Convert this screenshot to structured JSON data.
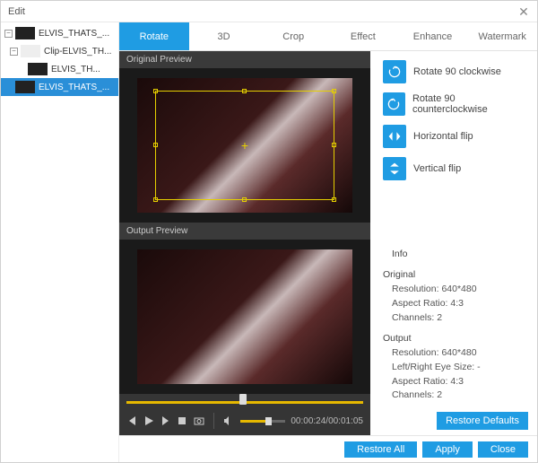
{
  "window": {
    "title": "Edit"
  },
  "tree": {
    "items": [
      {
        "label": "ELVIS_THATS_..."
      },
      {
        "label": "Clip-ELVIS_TH..."
      },
      {
        "label": "ELVIS_TH..."
      },
      {
        "label": "ELVIS_THATS_..."
      }
    ]
  },
  "tabs": {
    "items": [
      "Rotate",
      "3D",
      "Crop",
      "Effect",
      "Enhance",
      "Watermark"
    ],
    "active": 0
  },
  "preview": {
    "original_label": "Original Preview",
    "output_label": "Output Preview"
  },
  "playback": {
    "timecode": "00:00:24/00:01:05"
  },
  "rotate": {
    "options": [
      {
        "name": "rotate-cw",
        "label": "Rotate 90 clockwise"
      },
      {
        "name": "rotate-ccw",
        "label": "Rotate 90 counterclockwise"
      },
      {
        "name": "flip-h",
        "label": "Horizontal flip"
      },
      {
        "name": "flip-v",
        "label": "Vertical flip"
      }
    ]
  },
  "info": {
    "heading": "Info",
    "original": {
      "title": "Original",
      "resolution": "Resolution: 640*480",
      "aspect": "Aspect Ratio: 4:3",
      "channels": "Channels: 2"
    },
    "output": {
      "title": "Output",
      "resolution": "Resolution: 640*480",
      "eye": "Left/Right Eye Size: -",
      "aspect": "Aspect Ratio: 4:3",
      "channels": "Channels: 2"
    }
  },
  "buttons": {
    "restore_defaults": "Restore Defaults",
    "restore_all": "Restore All",
    "apply": "Apply",
    "close": "Close"
  }
}
